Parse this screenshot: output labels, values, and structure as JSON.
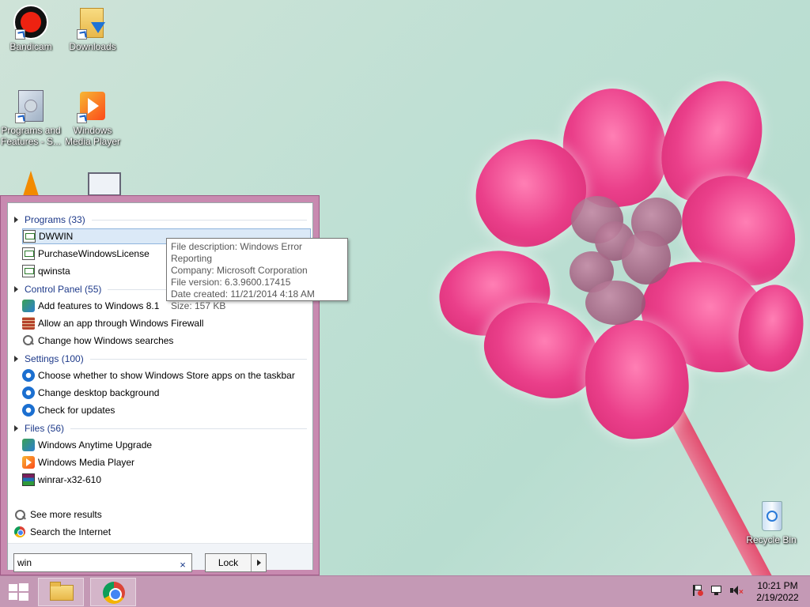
{
  "desktop": {
    "icons": [
      {
        "label": "Bandicam"
      },
      {
        "label": "Downloads"
      },
      {
        "label": "Programs and Features - S..."
      },
      {
        "label": "Windows Media Player"
      },
      {
        "label": "Recycle Bin"
      }
    ]
  },
  "search_panel": {
    "groups": {
      "programs": "Programs (33)",
      "control_panel": "Control Panel (55)",
      "settings": "Settings (100)",
      "files": "Files (56)"
    },
    "programs": [
      "DWWIN",
      "PurchaseWindowsLicense",
      "qwinsta"
    ],
    "control_panel": [
      "Add features to Windows 8.1",
      "Allow an app through Windows Firewall",
      "Change how Windows searches"
    ],
    "settings": [
      "Choose whether to show Windows Store apps on the taskbar",
      "Change desktop background",
      "Check for updates"
    ],
    "files": [
      "Windows Anytime Upgrade",
      "Windows Media Player",
      "winrar-x32-610"
    ],
    "see_more": "See more results",
    "search_internet": "Search the Internet",
    "search_value": "win",
    "clear_symbol": "×",
    "lock_label": "Lock"
  },
  "tooltip": {
    "lines": [
      "File description: Windows Error Reporting",
      "Company: Microsoft Corporation",
      "File version: 6.3.9600.17415",
      "Date created: 11/21/2014 4:18 AM",
      "Size: 157 KB"
    ]
  },
  "taskbar": {
    "time": "10:21 PM",
    "date": "2/19/2022"
  },
  "colors": {
    "panel_frame": "#c88ab0",
    "taskbar": "#c499b5",
    "group_header": "#1e3a8a",
    "selection": "#dbe9f7"
  },
  "icons": [
    "windows-logo-icon",
    "file-explorer-icon",
    "chrome-icon",
    "flag-icon",
    "network-icon",
    "volume-muted-icon"
  ]
}
